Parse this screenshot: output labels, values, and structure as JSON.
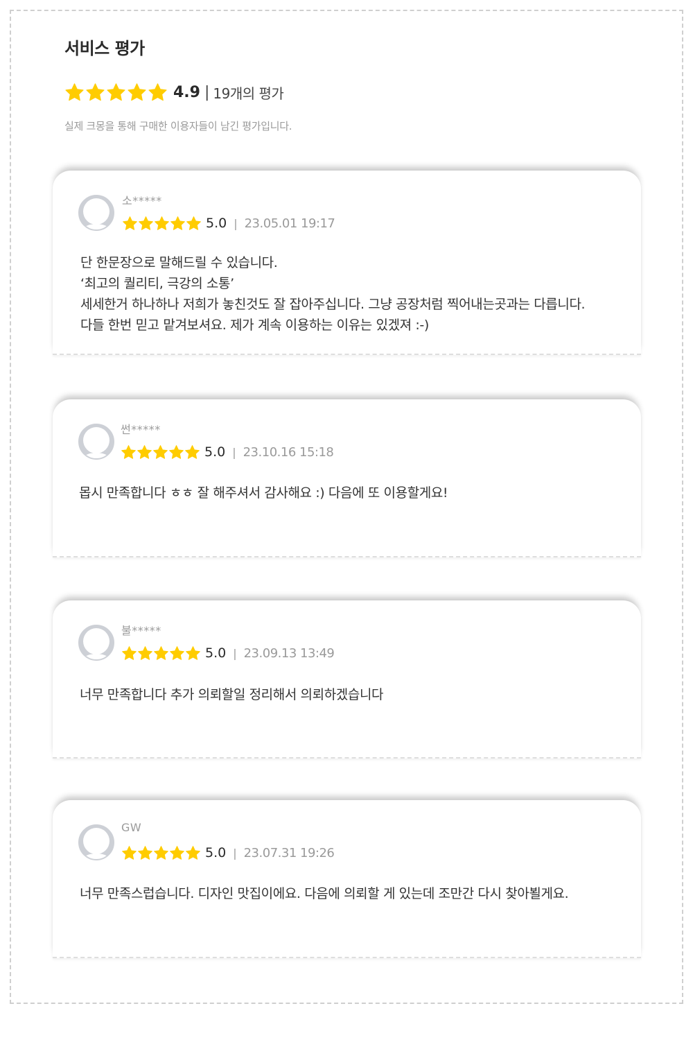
{
  "header": {
    "title": "서비스 평가",
    "rating": "4.9",
    "separator": "|",
    "count": "19개의 평가",
    "stars": 5,
    "description": "실제 크몽을 통해 구매한 이용자들이 남긴 평가입니다."
  },
  "colors": {
    "star": "#FFCC00",
    "muted": "#9a9a9a",
    "text": "#333333"
  },
  "reviews": [
    {
      "name": "소*****",
      "score": "5.0",
      "separator": "|",
      "date": "23.05.01 19:17",
      "stars": 5,
      "lines": [
        "단 한문장으로 말해드릴 수 있습니다.",
        "‘최고의 퀄리티, 극강의 소통’",
        "세세한거 하나하나 저희가 놓친것도 잘 잡아주십니다. 그냥 공장처럼 찍어내는곳과는 다릅니다.",
        "다들 한번 믿고 맡겨보셔요. 제가 계속 이용하는 이유는 있겠져 :-)"
      ]
    },
    {
      "name": "썬*****",
      "score": "5.0",
      "separator": "|",
      "date": "23.10.16 15:18",
      "stars": 5,
      "lines": [
        "몹시 만족합니다 ㅎㅎ 잘 해주셔서 감사해요 :) 다음에 또 이용할게요!"
      ]
    },
    {
      "name": "불*****",
      "score": "5.0",
      "separator": "|",
      "date": "23.09.13 13:49",
      "stars": 5,
      "lines": [
        "너무 만족합니다 추가 의뢰할일 정리해서 의뢰하겠습니다"
      ]
    },
    {
      "name": "GW",
      "score": "5.0",
      "separator": "|",
      "date": "23.07.31 19:26",
      "stars": 5,
      "lines": [
        "너무 만족스럽습니다. 디자인 맛집이에요. 다음에 의뢰할 게 있는데 조만간 다시 찾아뵐게요."
      ]
    }
  ]
}
